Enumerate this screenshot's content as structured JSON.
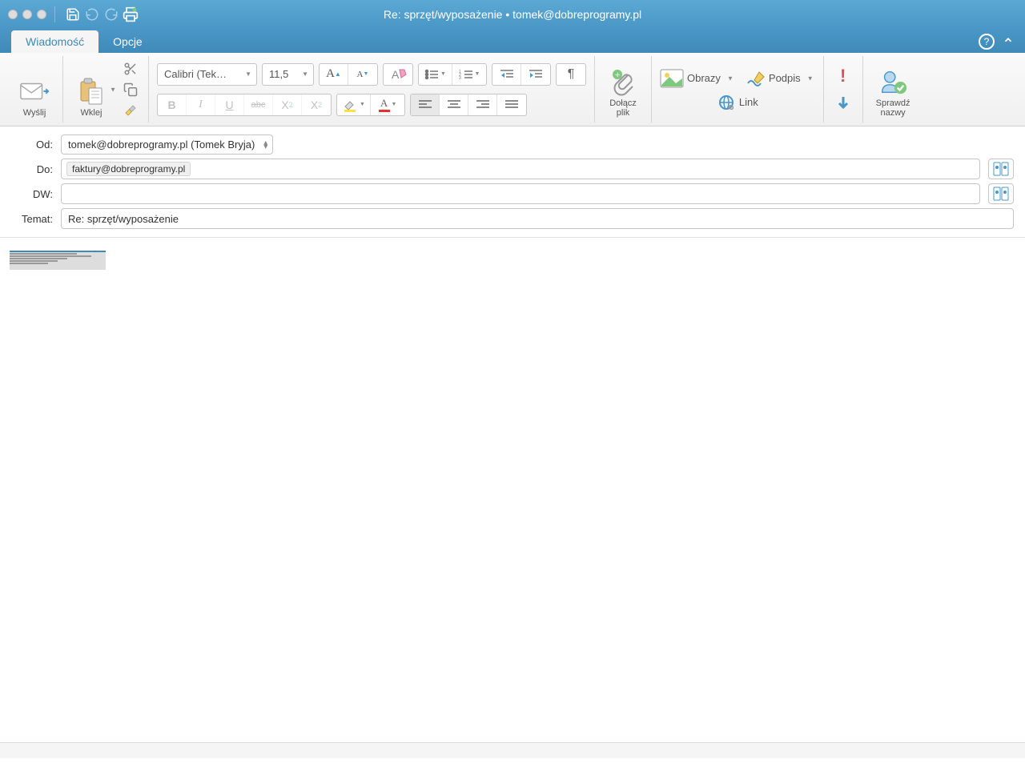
{
  "window": {
    "title": "Re: sprzęt/wyposażenie • tomek@dobreprogramy.pl"
  },
  "tabs": {
    "message": "Wiadomość",
    "options": "Opcje"
  },
  "ribbon": {
    "send": "Wyślij",
    "paste": "Wklej",
    "font_name": "Calibri (Tek…",
    "font_size": "11,5",
    "attach": "Dołącz\nplik",
    "images": "Obrazy",
    "signature": "Podpis",
    "link": "Link",
    "check_names": "Sprawdź\nnazwy"
  },
  "form": {
    "from_label": "Od:",
    "from_value": "tomek@dobreprogramy.pl (Tomek Bryja)",
    "to_label": "Do:",
    "to_chip": "faktury@dobreprogramy.pl",
    "cc_label": "DW:",
    "subject_label": "Temat:",
    "subject_value": "Re: sprzęt/wyposażenie"
  }
}
